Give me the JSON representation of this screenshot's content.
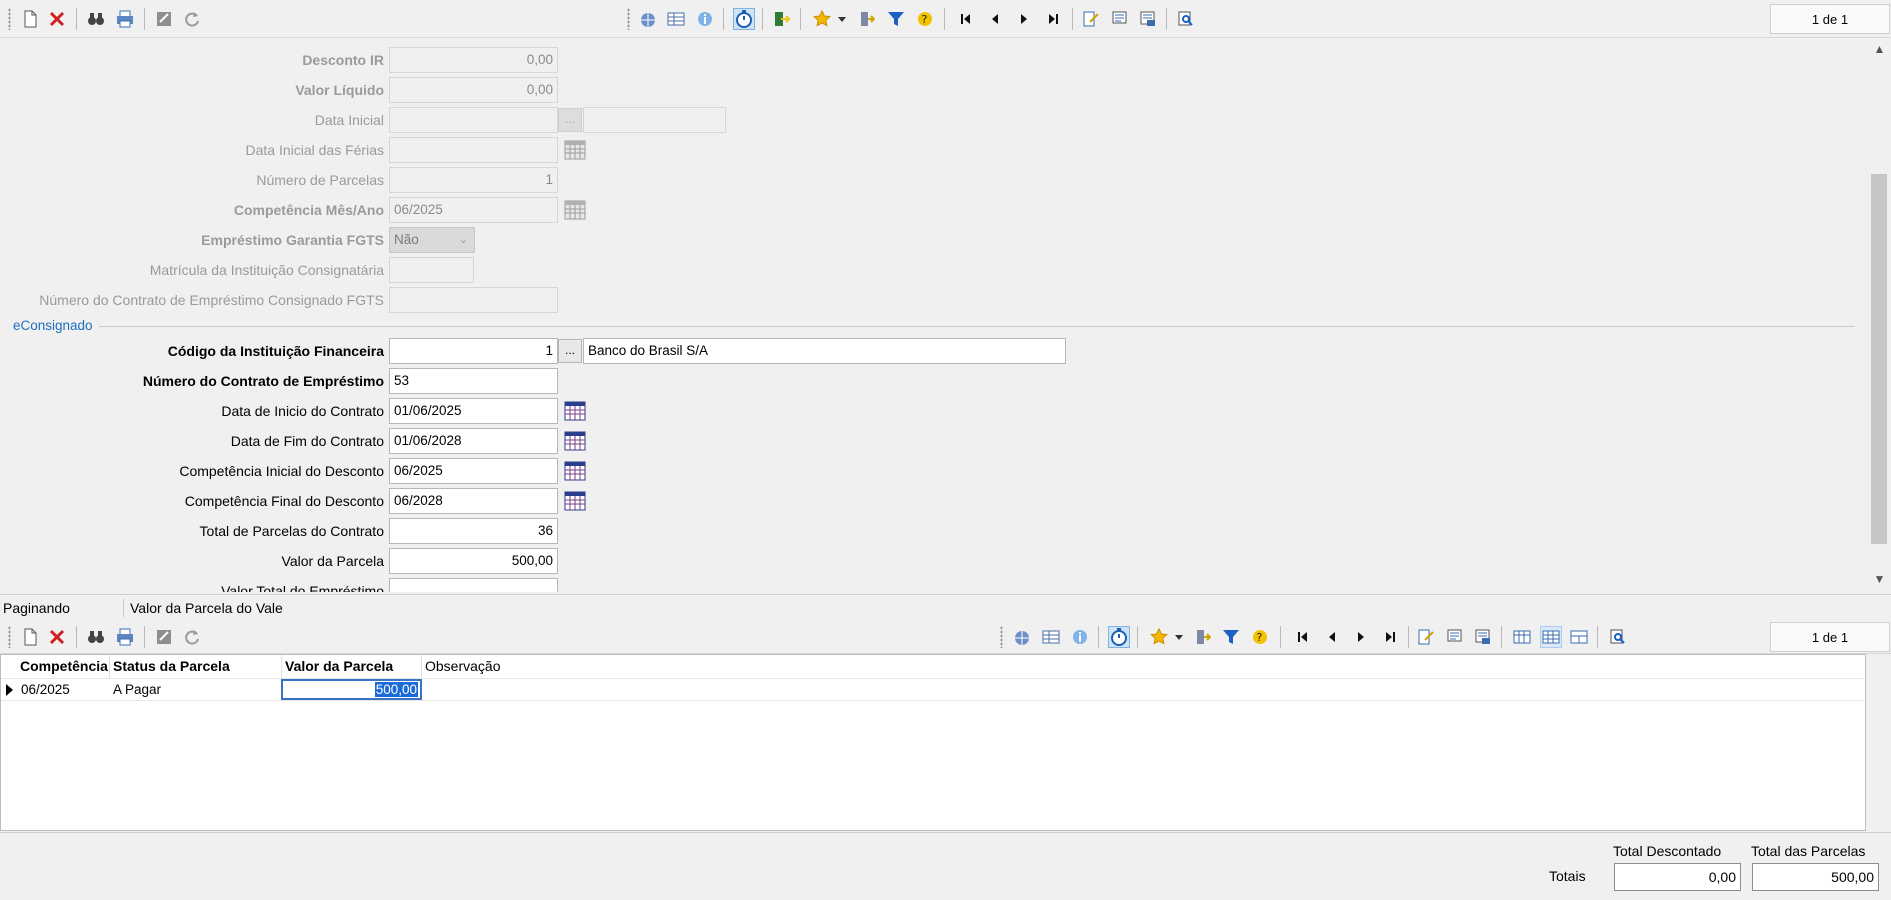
{
  "top_toolbar": {
    "record_position": "1 de 1"
  },
  "form": {
    "desconto_ir": {
      "label": "Desconto IR",
      "value": "0,00"
    },
    "valor_liquido": {
      "label": "Valor Líquido",
      "value": "0,00"
    },
    "data_inicial": {
      "label": "Data Inicial",
      "value": "",
      "ellipsis": "...",
      "extra": ""
    },
    "data_inicial_ferias": {
      "label": "Data Inicial das Férias",
      "value": ""
    },
    "numero_parcelas": {
      "label": "Número de Parcelas",
      "value": "1"
    },
    "competencia_mes_ano": {
      "label": "Competência Mês/Ano",
      "value": "06/2025"
    },
    "emprestimo_garantia_fgts": {
      "label": "Empréstimo Garantia FGTS",
      "value": "Não"
    },
    "matricula_instituicao": {
      "label": "Matrícula da Instituição Consignatária",
      "value": ""
    },
    "numero_contrato_fgts": {
      "label": "Número do Contrato de Empréstimo Consignado FGTS",
      "value": ""
    },
    "group_title": "eConsignado",
    "codigo_instituicao": {
      "label": "Código da Instituição Financeira",
      "value": "1",
      "ellipsis": "...",
      "name": "Banco do Brasil S/A"
    },
    "numero_contrato": {
      "label": "Número do Contrato de Empréstimo",
      "value": "53"
    },
    "data_inicio_contrato": {
      "label": "Data de Inicio do Contrato",
      "value": "01/06/2025"
    },
    "data_fim_contrato": {
      "label": "Data de Fim do Contrato",
      "value": "01/06/2028"
    },
    "competencia_inicial": {
      "label": "Competência Inicial do Desconto",
      "value": "06/2025"
    },
    "competencia_final": {
      "label": "Competência Final do Desconto",
      "value": "06/2028"
    },
    "total_parcelas": {
      "label": "Total de Parcelas do Contrato",
      "value": "36"
    },
    "valor_parcela": {
      "label": "Valor da Parcela",
      "value": "500,00"
    },
    "valor_total_emprestimo": {
      "label": "Valor Total do Empréstimo",
      "value": ""
    }
  },
  "statusbar": {
    "left": "Paginando",
    "right": "Valor da Parcela do Vale"
  },
  "detail_toolbar": {
    "record_position": "1 de 1"
  },
  "grid": {
    "columns": [
      "Competência",
      "Status da Parcela",
      "Valor da Parcela",
      "Observação"
    ],
    "rows": [
      {
        "competencia": "06/2025",
        "status": "A Pagar",
        "valor": "500,00",
        "observacao": ""
      }
    ]
  },
  "footer": {
    "totais_label": "Totais",
    "total_descontado": {
      "label": "Total Descontado",
      "value": "0,00"
    },
    "total_parcelas": {
      "label": "Total das Parcelas",
      "value": "500,00"
    }
  },
  "colors": {
    "accent": "#1c6fc0",
    "selection": "#1a6bd6"
  }
}
